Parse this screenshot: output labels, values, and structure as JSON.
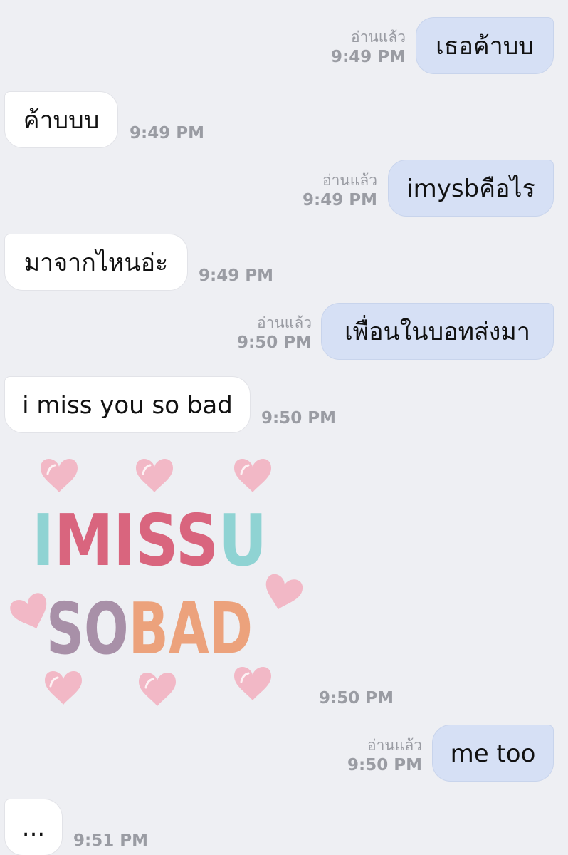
{
  "messages": [
    {
      "direction": "outgoing",
      "text": "เธอค้าบบ",
      "read_label": "อ่านแล้ว",
      "time": "9:49 PM"
    },
    {
      "direction": "incoming",
      "text": "ค้าบบบ",
      "time": "9:49 PM"
    },
    {
      "direction": "outgoing",
      "text": "imysbคือไร",
      "read_label": "อ่านแล้ว",
      "time": "9:49 PM"
    },
    {
      "direction": "incoming",
      "text": "มาจากไหนอ่ะ",
      "time": "9:49 PM"
    },
    {
      "direction": "outgoing",
      "text": "เพื่อนในบอทส่งมา",
      "read_label": "อ่านแล้ว",
      "time": "9:50 PM"
    },
    {
      "direction": "incoming",
      "text": "i miss you so bad",
      "time": "9:50 PM"
    },
    {
      "direction": "incoming",
      "type": "sticker",
      "sticker_text_line1": "IMISSU",
      "sticker_text_line2": "SOBAD",
      "time": "9:50 PM"
    },
    {
      "direction": "outgoing",
      "text": "me too",
      "read_label": "อ่านแล้ว",
      "time": "9:50 PM"
    },
    {
      "direction": "incoming",
      "text": "...",
      "time": "9:51 PM"
    }
  ],
  "colors": {
    "background": "#eeeff3",
    "outgoing_bubble": "#d6e0f5",
    "incoming_bubble": "#ffffff",
    "meta_text": "#9a9ca3",
    "sticker_heart": "#f2b8c6",
    "sticker_teal": "#8fd3d3",
    "sticker_rose": "#d9657e",
    "sticker_mauve": "#a890a8",
    "sticker_peach": "#eca27c"
  }
}
